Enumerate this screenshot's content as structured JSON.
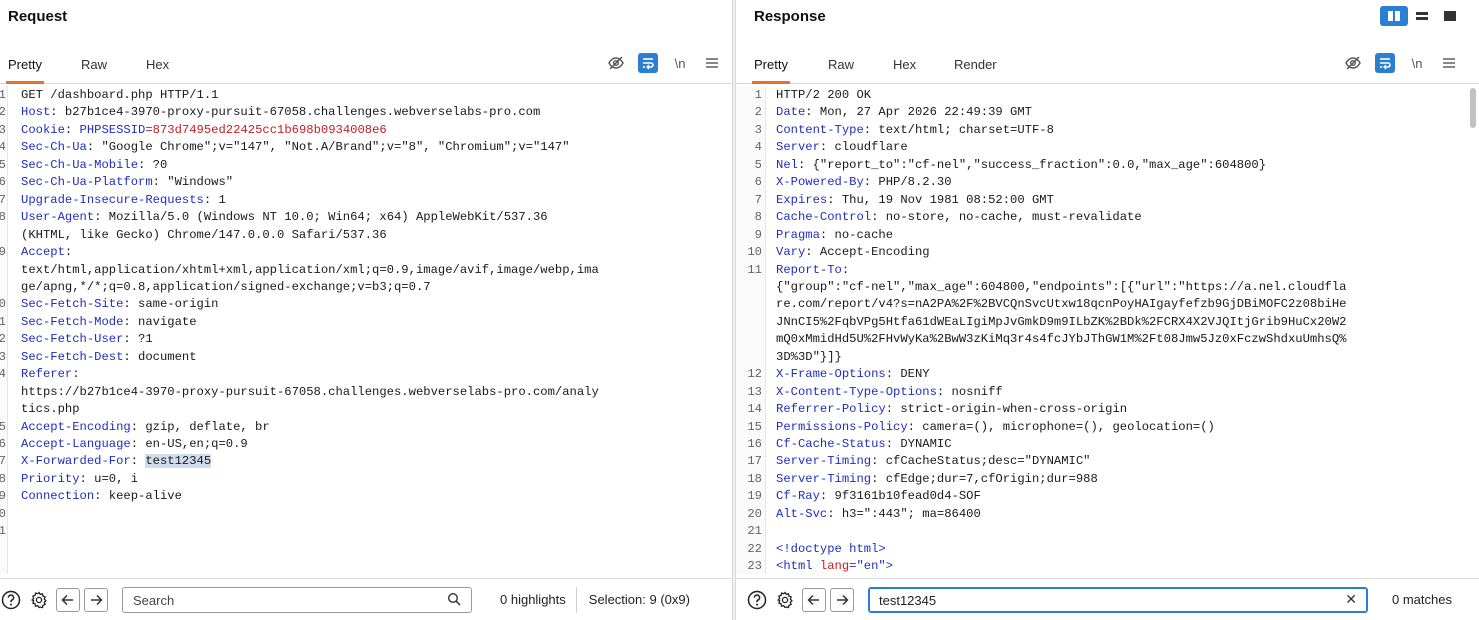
{
  "request": {
    "title": "Request",
    "tabs": [
      {
        "label": "Pretty",
        "active": true
      },
      {
        "label": "Raw"
      },
      {
        "label": "Hex"
      }
    ],
    "toolbar": {
      "icons": [
        "eye-off-icon",
        "wrap-icon",
        "newline-icon",
        "menu-icon"
      ],
      "newline_label": "\\n"
    },
    "lines": [
      {
        "num": "1",
        "parts": [
          {
            "t": "GET /dashboard.php HTTP/1.1"
          }
        ]
      },
      {
        "num": "2",
        "parts": [
          {
            "t": "Host",
            "c": "hk"
          },
          {
            "t": ": b27b1ce4-3970-proxy-pursuit-67058.challenges.webverselabs-pro.com"
          }
        ]
      },
      {
        "num": "3",
        "parts": [
          {
            "t": "Cookie",
            "c": "hk"
          },
          {
            "t": ": "
          },
          {
            "t": "PHPSESSID",
            "c": "hk"
          },
          {
            "t": "=873d7495ed22425cc1b698b0934008e6",
            "c": "sv"
          }
        ]
      },
      {
        "num": "4",
        "parts": [
          {
            "t": "Sec-Ch-Ua",
            "c": "hk"
          },
          {
            "t": ": \"Google Chrome\";v=\"147\", \"Not.A/Brand\";v=\"8\", \"Chromium\";v=\"147\""
          }
        ]
      },
      {
        "num": "5",
        "parts": [
          {
            "t": "Sec-Ch-Ua-Mobile",
            "c": "hk"
          },
          {
            "t": ": ?0"
          }
        ]
      },
      {
        "num": "6",
        "parts": [
          {
            "t": "Sec-Ch-Ua-Platform",
            "c": "hk"
          },
          {
            "t": ": \"Windows\""
          }
        ]
      },
      {
        "num": "7",
        "parts": [
          {
            "t": "Upgrade-Insecure-Requests",
            "c": "hk"
          },
          {
            "t": ": 1"
          }
        ]
      },
      {
        "num": "8",
        "parts": [
          {
            "t": "User-Agent",
            "c": "hk"
          },
          {
            "t": ": Mozilla/5.0 (Windows NT 10.0; Win64; x64) AppleWebKit/537.36"
          }
        ]
      },
      {
        "num": "",
        "parts": [
          {
            "t": "(KHTML, like Gecko) Chrome/147.0.0.0 Safari/537.36"
          }
        ]
      },
      {
        "num": "9",
        "parts": [
          {
            "t": "Accept",
            "c": "hk"
          },
          {
            "t": ":"
          }
        ]
      },
      {
        "num": "",
        "parts": [
          {
            "t": "text/html,application/xhtml+xml,application/xml;q=0.9,image/avif,image/webp,ima"
          }
        ]
      },
      {
        "num": "",
        "parts": [
          {
            "t": "ge/apng,*/*;q=0.8,application/signed-exchange;v=b3;q=0.7"
          }
        ]
      },
      {
        "num": "10",
        "parts": [
          {
            "t": "Sec-Fetch-Site",
            "c": "hk"
          },
          {
            "t": ": same-origin"
          }
        ]
      },
      {
        "num": "11",
        "parts": [
          {
            "t": "Sec-Fetch-Mode",
            "c": "hk"
          },
          {
            "t": ": navigate"
          }
        ]
      },
      {
        "num": "12",
        "parts": [
          {
            "t": "Sec-Fetch-User",
            "c": "hk"
          },
          {
            "t": ": ?1"
          }
        ]
      },
      {
        "num": "13",
        "parts": [
          {
            "t": "Sec-Fetch-Dest",
            "c": "hk"
          },
          {
            "t": ": document"
          }
        ]
      },
      {
        "num": "14",
        "parts": [
          {
            "t": "Referer",
            "c": "hk"
          },
          {
            "t": ":"
          }
        ]
      },
      {
        "num": "",
        "parts": [
          {
            "t": "https://b27b1ce4-3970-proxy-pursuit-67058.challenges.webverselabs-pro.com/analy"
          }
        ]
      },
      {
        "num": "",
        "parts": [
          {
            "t": "tics.php"
          }
        ]
      },
      {
        "num": "15",
        "parts": [
          {
            "t": "Accept-Encoding",
            "c": "hk"
          },
          {
            "t": ": gzip, deflate, br"
          }
        ]
      },
      {
        "num": "16",
        "parts": [
          {
            "t": "Accept-Language",
            "c": "hk"
          },
          {
            "t": ": en-US,en;q=0.9"
          }
        ]
      },
      {
        "num": "17",
        "parts": [
          {
            "t": "X-Forwarded-For",
            "c": "hk"
          },
          {
            "t": ": "
          },
          {
            "t": "test12345",
            "c": "hl"
          }
        ]
      },
      {
        "num": "18",
        "parts": [
          {
            "t": "Priority",
            "c": "hk"
          },
          {
            "t": ": u=0, i"
          }
        ]
      },
      {
        "num": "19",
        "parts": [
          {
            "t": "Connection",
            "c": "hk"
          },
          {
            "t": ": keep-alive"
          }
        ]
      },
      {
        "num": "20",
        "parts": []
      },
      {
        "num": "21",
        "parts": []
      }
    ],
    "footer": {
      "search_placeholder": "Search",
      "search_value": "",
      "highlights": "0 highlights",
      "selection": "Selection: 9 (0x9)"
    }
  },
  "response": {
    "title": "Response",
    "tabs": [
      {
        "label": "Pretty",
        "active": true
      },
      {
        "label": "Raw"
      },
      {
        "label": "Hex"
      },
      {
        "label": "Render"
      }
    ],
    "toolbar": {
      "icons": [
        "eye-off-icon",
        "wrap-icon",
        "newline-icon",
        "menu-icon"
      ],
      "newline_label": "\\n"
    },
    "lines": [
      {
        "num": "1",
        "parts": [
          {
            "t": "HTTP/2 200 OK"
          }
        ]
      },
      {
        "num": "2",
        "parts": [
          {
            "t": "Date",
            "c": "hk"
          },
          {
            "t": ": Mon, 27 Apr 2026 22:49:39 GMT"
          }
        ]
      },
      {
        "num": "3",
        "parts": [
          {
            "t": "Content-Type",
            "c": "hk"
          },
          {
            "t": ": text/html; charset=UTF-8"
          }
        ]
      },
      {
        "num": "4",
        "parts": [
          {
            "t": "Server",
            "c": "hk"
          },
          {
            "t": ": cloudflare"
          }
        ]
      },
      {
        "num": "5",
        "parts": [
          {
            "t": "Nel",
            "c": "hk"
          },
          {
            "t": ": {\"report_to\":\"cf-nel\",\"success_fraction\":0.0,\"max_age\":604800}"
          }
        ]
      },
      {
        "num": "6",
        "parts": [
          {
            "t": "X-Powered-By",
            "c": "hk"
          },
          {
            "t": ": PHP/8.2.30"
          }
        ]
      },
      {
        "num": "7",
        "parts": [
          {
            "t": "Expires",
            "c": "hk"
          },
          {
            "t": ": Thu, 19 Nov 1981 08:52:00 GMT"
          }
        ]
      },
      {
        "num": "8",
        "parts": [
          {
            "t": "Cache-Control",
            "c": "hk"
          },
          {
            "t": ": no-store, no-cache, must-revalidate"
          }
        ]
      },
      {
        "num": "9",
        "parts": [
          {
            "t": "Pragma",
            "c": "hk"
          },
          {
            "t": ": no-cache"
          }
        ]
      },
      {
        "num": "10",
        "parts": [
          {
            "t": "Vary",
            "c": "hk"
          },
          {
            "t": ": Accept-Encoding"
          }
        ]
      },
      {
        "num": "11",
        "parts": [
          {
            "t": "Report-To",
            "c": "hk"
          },
          {
            "t": ":"
          }
        ]
      },
      {
        "num": "",
        "parts": [
          {
            "t": "{\"group\":\"cf-nel\",\"max_age\":604800,\"endpoints\":[{\"url\":\"https://a.nel.cloudfla"
          }
        ]
      },
      {
        "num": "",
        "parts": [
          {
            "t": "re.com/report/v4?s=nA2PA%2F%2BVCQnSvcUtxw18qcnPoyHAIgayfefzb9GjDBiMOFC2z08biHe"
          }
        ]
      },
      {
        "num": "",
        "parts": [
          {
            "t": "JNnCI5%2FqbVPg5Htfa61dWEaLIgiMpJvGmkD9m9ILbZK%2BDk%2FCRX4X2VJQItjGrib9HuCx20W2"
          }
        ]
      },
      {
        "num": "",
        "parts": [
          {
            "t": "mQ0xMmidHd5U%2FHvWyKa%2BwW3zKiMq3r4s4fcJYbJThGW1M%2Ft08Jmw5Jz0xFczwShdxuUmhsQ%"
          }
        ]
      },
      {
        "num": "",
        "parts": [
          {
            "t": "3D%3D\"}]}"
          }
        ]
      },
      {
        "num": "12",
        "parts": [
          {
            "t": "X-Frame-Options",
            "c": "hk"
          },
          {
            "t": ": DENY"
          }
        ]
      },
      {
        "num": "13",
        "parts": [
          {
            "t": "X-Content-Type-Options",
            "c": "hk"
          },
          {
            "t": ": nosniff"
          }
        ]
      },
      {
        "num": "14",
        "parts": [
          {
            "t": "Referrer-Policy",
            "c": "hk"
          },
          {
            "t": ": strict-origin-when-cross-origin"
          }
        ]
      },
      {
        "num": "15",
        "parts": [
          {
            "t": "Permissions-Policy",
            "c": "hk"
          },
          {
            "t": ": camera=(), microphone=(), geolocation=()"
          }
        ]
      },
      {
        "num": "16",
        "parts": [
          {
            "t": "Cf-Cache-Status",
            "c": "hk"
          },
          {
            "t": ": DYNAMIC"
          }
        ]
      },
      {
        "num": "17",
        "parts": [
          {
            "t": "Server-Timing",
            "c": "hk"
          },
          {
            "t": ": cfCacheStatus;desc=\"DYNAMIC\""
          }
        ]
      },
      {
        "num": "18",
        "parts": [
          {
            "t": "Server-Timing",
            "c": "hk"
          },
          {
            "t": ": cfEdge;dur=7,cfOrigin;dur=988"
          }
        ]
      },
      {
        "num": "19",
        "parts": [
          {
            "t": "Cf-Ray",
            "c": "hk"
          },
          {
            "t": ": 9f3161b10fead0d4-SOF"
          }
        ]
      },
      {
        "num": "20",
        "parts": [
          {
            "t": "Alt-Svc",
            "c": "hk"
          },
          {
            "t": ": h3=\":443\"; ma=86400"
          }
        ]
      },
      {
        "num": "21",
        "parts": []
      },
      {
        "num": "22",
        "parts": [
          {
            "t": "<!doctype html>",
            "c": "tg"
          }
        ]
      },
      {
        "num": "23",
        "parts": [
          {
            "t": "<html ",
            "c": "tg"
          },
          {
            "t": "lang",
            "c": "at"
          },
          {
            "t": "=\"en\">",
            "c": "tg"
          }
        ]
      }
    ],
    "footer": {
      "search_placeholder": "Search",
      "search_value": "test12345",
      "matches": "0 matches"
    }
  },
  "layout_buttons": [
    {
      "name": "layout-split-icon",
      "active": true
    },
    {
      "name": "layout-horizontal-icon"
    },
    {
      "name": "layout-single-icon"
    }
  ],
  "colors": {
    "accent": "#e8712a",
    "blue": "#2b7fd3",
    "header_key": "#1f2fbf",
    "string_value": "#c81e1e",
    "highlight": "#cfdcec"
  }
}
